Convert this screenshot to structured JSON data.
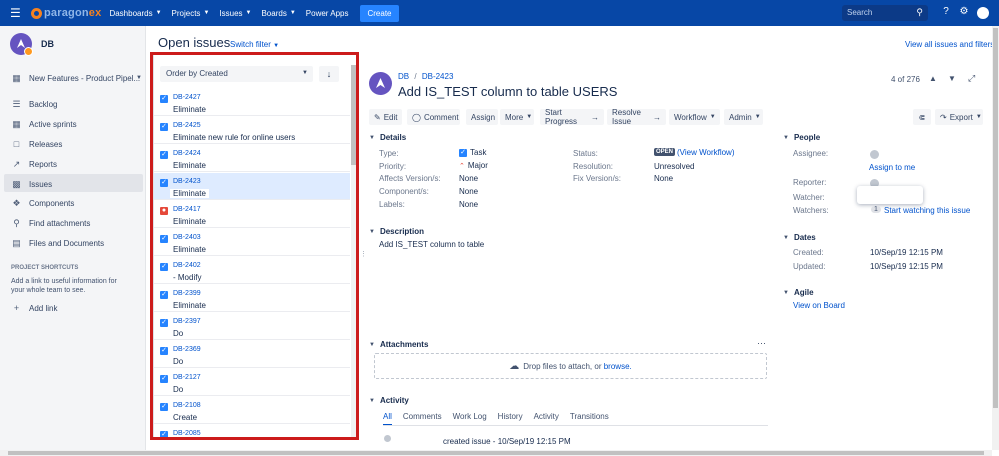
{
  "topbar": {
    "logo_main": "paragon",
    "logo_suffix": "ex",
    "nav": [
      "Dashboards",
      "Projects",
      "Issues",
      "Boards",
      "Power Apps"
    ],
    "create_label": "Create",
    "search_placeholder": "Search"
  },
  "sidebar": {
    "project_name": "DB",
    "board_selector": "New Features - Product Pipel...",
    "items": [
      {
        "label": "Backlog",
        "icon": "backlog-icon"
      },
      {
        "label": "Active sprints",
        "icon": "sprints-icon"
      },
      {
        "label": "Releases",
        "icon": "releases-icon"
      },
      {
        "label": "Reports",
        "icon": "reports-icon"
      },
      {
        "label": "Issues",
        "icon": "issues-icon"
      },
      {
        "label": "Components",
        "icon": "components-icon"
      },
      {
        "label": "Find attachments",
        "icon": "attachments-icon"
      },
      {
        "label": "Files and Documents",
        "icon": "documents-icon"
      }
    ],
    "shortcuts_heading": "PROJECT SHORTCUTS",
    "shortcuts_text": "Add a link to useful information for your whole team to see.",
    "add_link": "Add link"
  },
  "issues_panel": {
    "title": "Open issues",
    "switch_filter": "Switch filter",
    "order_by": "Order by Created",
    "rows": [
      {
        "key": "DB-2427",
        "summary": "Eliminate",
        "type": "task"
      },
      {
        "key": "DB-2425",
        "summary": "Eliminate   new rule for online users",
        "type": "task"
      },
      {
        "key": "DB-2424",
        "summary": "Eliminate",
        "type": "task"
      },
      {
        "key": "DB-2423",
        "summary": "Eliminate",
        "type": "task"
      },
      {
        "key": "DB-2417",
        "summary": "Eliminate",
        "type": "bug"
      },
      {
        "key": "DB-2403",
        "summary": "Eliminate",
        "type": "task"
      },
      {
        "key": "DB-2402",
        "summary": "- Modify",
        "type": "task"
      },
      {
        "key": "DB-2399",
        "summary": "Eliminate",
        "type": "task"
      },
      {
        "key": "DB-2397",
        "summary": "Do",
        "type": "task"
      },
      {
        "key": "DB-2369",
        "summary": "Do",
        "type": "task"
      },
      {
        "key": "DB-2127",
        "summary": "Do",
        "type": "task"
      },
      {
        "key": "DB-2108",
        "summary": "Create",
        "type": "task"
      },
      {
        "key": "DB-2085",
        "summary": "",
        "type": "task"
      }
    ]
  },
  "header": {
    "view_all": "View all issues and filters",
    "breadcrumb_project": "DB",
    "breadcrumb_key": "DB-2423",
    "issue_title": "Add IS_TEST column to table USERS",
    "pager": "4 of 276"
  },
  "toolbar": {
    "edit": "Edit",
    "comment": "Comment",
    "assign": "Assign",
    "more": "More",
    "start_progress": "Start Progress",
    "resolve": "Resolve Issue",
    "workflow": "Workflow",
    "admin": "Admin",
    "export": "Export"
  },
  "details": {
    "heading": "Details",
    "type_label": "Type:",
    "type_value": "Task",
    "priority_label": "Priority:",
    "priority_value": "Major",
    "affects_label": "Affects Version/s:",
    "affects_value": "None",
    "components_label": "Component/s:",
    "components_value": "None",
    "labels_label": "Labels:",
    "labels_value": "None",
    "status_label": "Status:",
    "status_value": "OPEN",
    "view_workflow": "(View Workflow)",
    "resolution_label": "Resolution:",
    "resolution_value": "Unresolved",
    "fixversion_label": "Fix Version/s:",
    "fixversion_value": "None"
  },
  "description": {
    "heading": "Description",
    "text": "Add IS_TEST column to table"
  },
  "attachments": {
    "heading": "Attachments",
    "drop_text": "Drop files to attach, or",
    "browse": "browse."
  },
  "activity": {
    "heading": "Activity",
    "tabs": [
      "All",
      "Comments",
      "Work Log",
      "History",
      "Activity",
      "Transitions"
    ],
    "entry": "created issue - 10/Sep/19 12:15 PM"
  },
  "people": {
    "heading": "People",
    "assignee_label": "Assignee:",
    "assign_to_me": "Assign to me",
    "reporter_label": "Reporter:",
    "watcher_label": "Watcher:",
    "watchers_label": "Watchers:",
    "watchers_count": "1",
    "start_watching": "Start watching this issue"
  },
  "dates": {
    "heading": "Dates",
    "created_label": "Created:",
    "created_value": "10/Sep/19 12:15 PM",
    "updated_label": "Updated:",
    "updated_value": "10/Sep/19 12:15 PM"
  },
  "agile": {
    "heading": "Agile",
    "view_on_board": "View on Board"
  },
  "colors": {
    "topbar": "#0747a6",
    "accent": "#0052cc",
    "highlight_box": "#cc1b1b",
    "logo_orange": "#f58220"
  }
}
